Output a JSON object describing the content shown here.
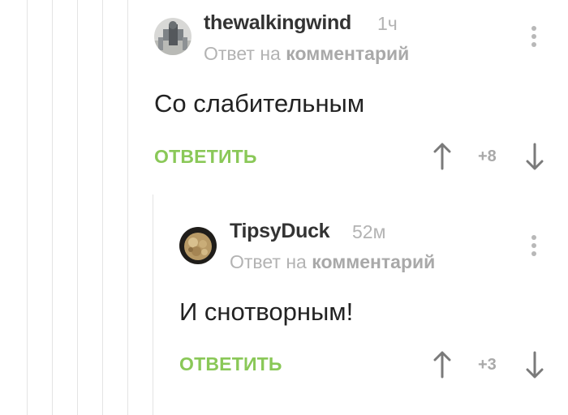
{
  "thread": {
    "comments": [
      {
        "username": "thewalkingwind",
        "time": "1ч",
        "reply_prefix": "Ответ на",
        "reply_link": "комментарий",
        "text": "Со слабительным",
        "reply_button": "ОТВЕТИТЬ",
        "rating": "+8",
        "upvote_icon": "arrow-up-icon",
        "downvote_icon": "arrow-down-icon",
        "more_icon": "more-vertical-icon"
      },
      {
        "username": "TipsyDuck",
        "time": "52м",
        "reply_prefix": "Ответ на",
        "reply_link": "комментарий",
        "text": "И снотворным!",
        "reply_button": "ОТВЕТИТЬ",
        "rating": "+3",
        "upvote_icon": "arrow-up-icon",
        "downvote_icon": "arrow-down-icon",
        "more_icon": "more-vertical-icon"
      }
    ]
  },
  "colors": {
    "accent_green": "#8ac858",
    "muted_gray": "#b3b3b3",
    "thread_line": "#e4e4e4"
  }
}
